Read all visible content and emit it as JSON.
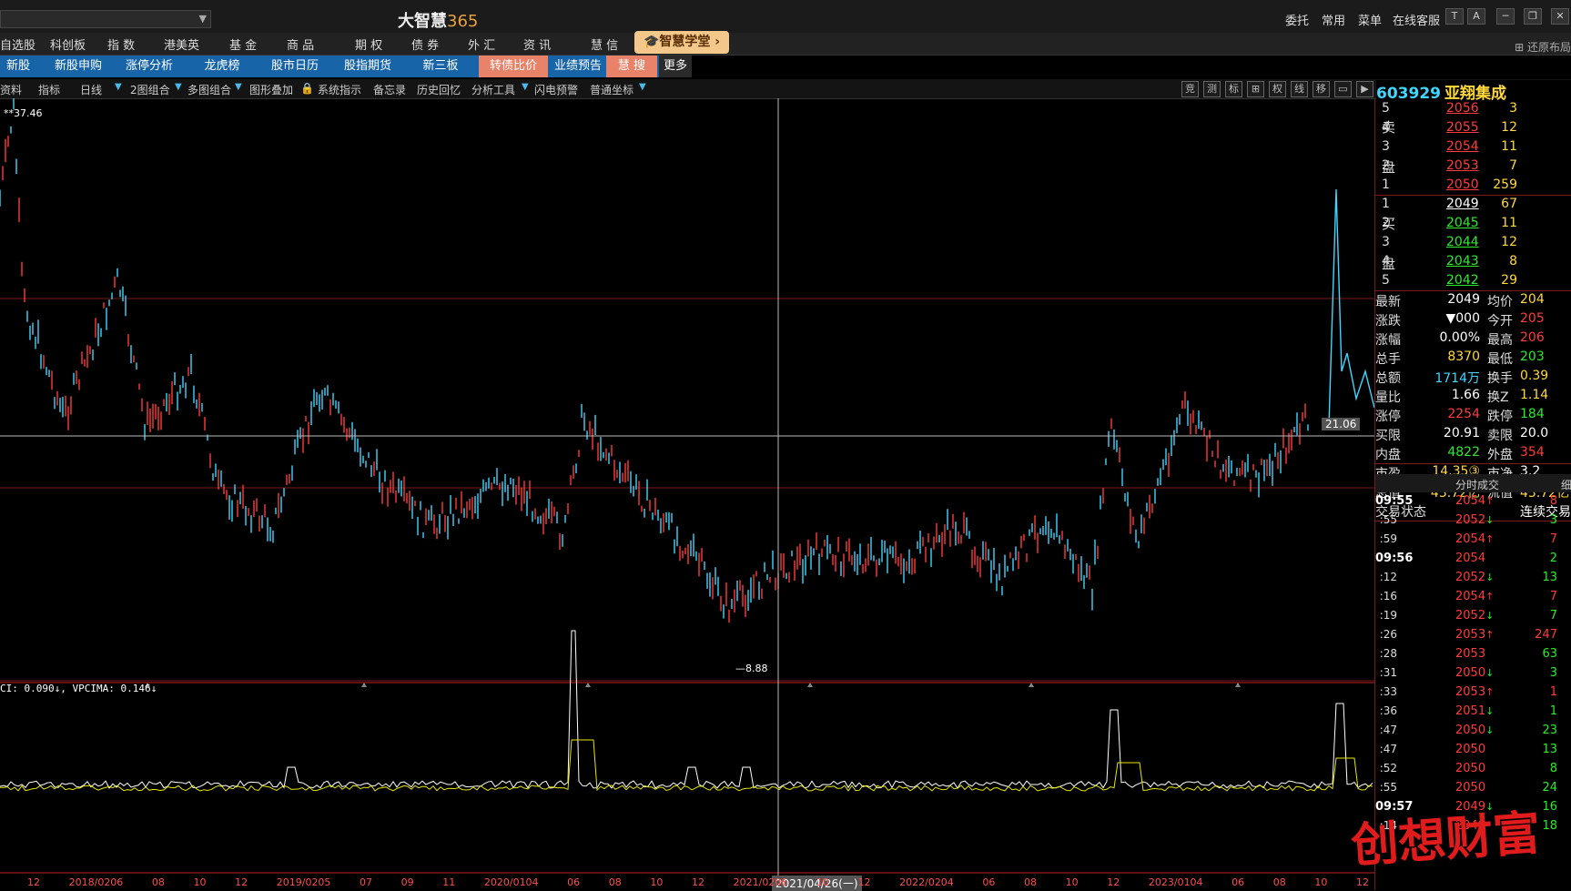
{
  "titlebar": {
    "app_title": "大智慧",
    "app_title_num": "365",
    "links": [
      "委托",
      "常用",
      "菜单",
      "在线客服"
    ]
  },
  "menu1": {
    "items": [
      "自选股",
      "科创板",
      "指 数",
      "港美英",
      "基 金",
      "商 品",
      "期 权",
      "债 券",
      "外 汇",
      "资 讯",
      "慧 信"
    ],
    "academy": "智慧学堂",
    "restore_layout": "还原布局"
  },
  "menu2": {
    "items": [
      "新股",
      "新股申购",
      "涨停分析",
      "龙虎榜",
      "股市日历",
      "股指期货",
      "新三板"
    ],
    "highlight": [
      "转债比价",
      "业绩预告",
      "慧 搜"
    ],
    "more": "更多"
  },
  "toolbar": {
    "items": [
      "资料",
      "指标",
      "日线",
      "2图组合",
      "多图组合",
      "图形叠加",
      "系统指示",
      "备忘录",
      "历史回忆",
      "分析工具",
      "闪电预警",
      "普通坐标"
    ],
    "right_icons": [
      "竞",
      "测",
      "标",
      "⊞",
      "权",
      "线",
      "移"
    ]
  },
  "chart": {
    "high_label": "37.46",
    "low_label": "8.88",
    "crosshair_price": "21.06",
    "crosshair_date": "2021/04/26(一)",
    "indicator_label": "CI: 0.090↓, VPCIMA: 0.146↓",
    "x_labels": [
      "12",
      "2018/02",
      "06",
      "08",
      "10",
      "12",
      "2019/02",
      "05",
      "07",
      "09",
      "11",
      "2020/01",
      "04",
      "06",
      "08",
      "10",
      "12",
      "2021/02",
      "06",
      "10",
      "12",
      "2022/02",
      "04",
      "06",
      "08",
      "10",
      "12",
      "2023/01",
      "04",
      "06",
      "08",
      "10",
      "12"
    ]
  },
  "stock": {
    "code": "603929",
    "name": "亚翔集成"
  },
  "orderbook": {
    "sell_label_1": "卖",
    "sell_label_2": "盘",
    "buy_label_1": "买",
    "buy_label_2": "盘",
    "sells": [
      {
        "level": "5",
        "price": "2056",
        "vol": "3"
      },
      {
        "level": "4",
        "price": "2055",
        "vol": "12"
      },
      {
        "level": "3",
        "price": "2054",
        "vol": "11"
      },
      {
        "level": "2",
        "price": "2053",
        "vol": "7"
      },
      {
        "level": "1",
        "price": "2050",
        "vol": "259"
      }
    ],
    "buys": [
      {
        "level": "1",
        "price": "2049",
        "vol": "67"
      },
      {
        "level": "2",
        "price": "2045",
        "vol": "11"
      },
      {
        "level": "3",
        "price": "2044",
        "vol": "12"
      },
      {
        "level": "4",
        "price": "2043",
        "vol": "8"
      },
      {
        "level": "5",
        "price": "2042",
        "vol": "29"
      }
    ]
  },
  "quote": {
    "rows": [
      {
        "l1": "最新",
        "v1": "2049",
        "c1": "white",
        "l2": "均价",
        "v2": "204",
        "c2": "yellow"
      },
      {
        "l1": "涨跌",
        "v1": "▼000",
        "c1": "white",
        "l2": "今开",
        "v2": "205",
        "c2": "red"
      },
      {
        "l1": "涨幅",
        "v1": "0.00%",
        "c1": "white",
        "l2": "最高",
        "v2": "206",
        "c2": "red"
      },
      {
        "l1": "总手",
        "v1": "8370",
        "c1": "yellow",
        "l2": "最低",
        "v2": "203",
        "c2": "green"
      },
      {
        "l1": "总额",
        "v1": "1714万",
        "c1": "cyan",
        "l2": "换手",
        "v2": "0.39",
        "c2": "yellow"
      },
      {
        "l1": "量比",
        "v1": "1.66",
        "c1": "white",
        "l2": "换Z",
        "v2": "1.14",
        "c2": "yellow"
      },
      {
        "l1": "涨停",
        "v1": "2254",
        "c1": "red",
        "l2": "跌停",
        "v2": "184",
        "c2": "green"
      },
      {
        "l1": "买限",
        "v1": "20.91",
        "c1": "white",
        "l2": "卖限",
        "v2": "20.0",
        "c2": "white"
      },
      {
        "l1": "内盘",
        "v1": "4822",
        "c1": "green",
        "l2": "外盘",
        "v2": "354",
        "c2": "red"
      },
      {
        "l1": "市盈",
        "v1": "14.35③",
        "c1": "yellow",
        "l2": "市净",
        "v2": "3.2",
        "c2": "white"
      },
      {
        "l1": "总值",
        "v1": "43.72亿",
        "c1": "yellow",
        "l2": "流值",
        "v2": "43.72亿",
        "c2": "yellow"
      },
      {
        "l1": "交易状态",
        "v1": "",
        "c1": "white",
        "l2": "",
        "v2": "连续交易",
        "c2": "white"
      }
    ]
  },
  "trades": {
    "header": "分时成交",
    "header_right": "细",
    "rows": [
      {
        "time": "09:55",
        "big": true,
        "price": "2054",
        "dir": "up",
        "vol": "8"
      },
      {
        "time": ":55",
        "big": false,
        "price": "2052",
        "dir": "down",
        "vol": "3"
      },
      {
        "time": ":59",
        "big": false,
        "price": "2054",
        "dir": "up",
        "vol": "7"
      },
      {
        "time": "09:56",
        "big": true,
        "price": "2054",
        "dir": "",
        "vol": "2"
      },
      {
        "time": ":12",
        "big": false,
        "price": "2052",
        "dir": "down",
        "vol": "13"
      },
      {
        "time": ":16",
        "big": false,
        "price": "2054",
        "dir": "up",
        "vol": "7"
      },
      {
        "time": ":19",
        "big": false,
        "price": "2052",
        "dir": "down",
        "vol": "7"
      },
      {
        "time": ":26",
        "big": false,
        "price": "2053",
        "dir": "up",
        "vol": "247"
      },
      {
        "time": ":28",
        "big": false,
        "price": "2053",
        "dir": "",
        "vol": "63"
      },
      {
        "time": ":31",
        "big": false,
        "price": "2050",
        "dir": "down",
        "vol": "3"
      },
      {
        "time": ":33",
        "big": false,
        "price": "2053",
        "dir": "up",
        "vol": "1"
      },
      {
        "time": ":36",
        "big": false,
        "price": "2051",
        "dir": "down",
        "vol": "1"
      },
      {
        "time": ":47",
        "big": false,
        "price": "2050",
        "dir": "down",
        "vol": "23"
      },
      {
        "time": ":47",
        "big": false,
        "price": "2050",
        "dir": "",
        "vol": "13"
      },
      {
        "time": ":52",
        "big": false,
        "price": "2050",
        "dir": "",
        "vol": "8"
      },
      {
        "time": ":55",
        "big": false,
        "price": "2050",
        "dir": "",
        "vol": "24"
      },
      {
        "time": "09:57",
        "big": true,
        "price": "2049",
        "dir": "down",
        "vol": "16"
      },
      {
        "time": ":14",
        "big": false,
        "price": "2049",
        "dir": "",
        "vol": "18"
      }
    ]
  },
  "watermark": "创想财富",
  "colors": {
    "up": "#ff3b3b",
    "down": "#2dea2d",
    "candle_down": "#3fd6ff",
    "grid": "#7a1a1a",
    "menu_blue": "#1864a8",
    "menu_highlight": "#e8836a"
  }
}
